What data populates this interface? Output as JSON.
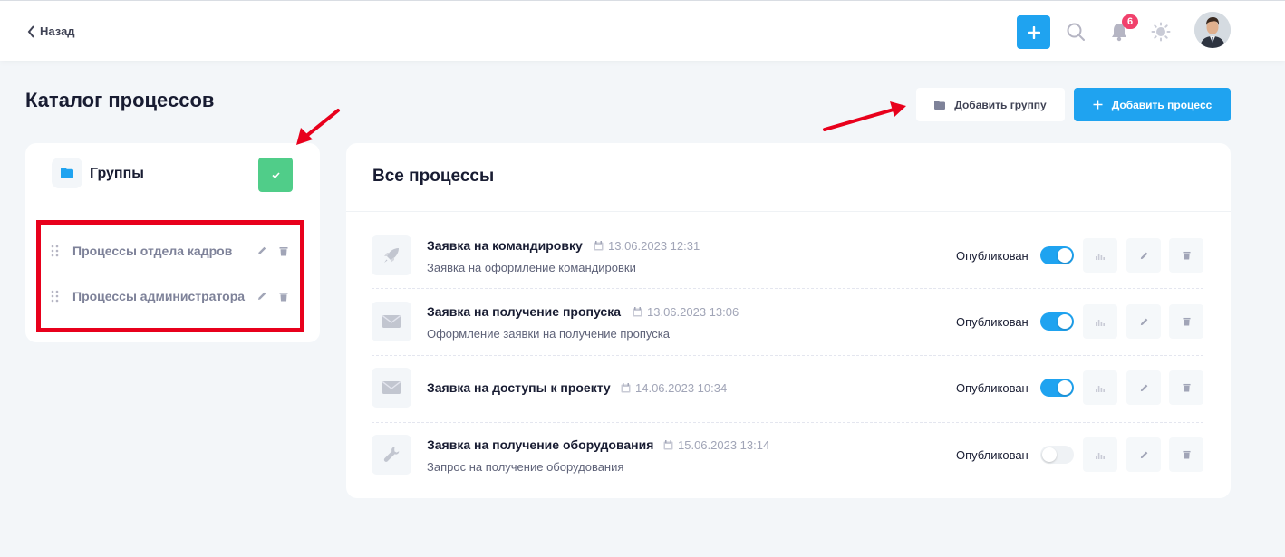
{
  "header": {
    "back_label": "Назад",
    "notifications_count": "6"
  },
  "page": {
    "title": "Каталог процессов",
    "add_group_label": "Добавить группу",
    "add_process_label": "Добавить процесс"
  },
  "groups": {
    "title": "Группы",
    "items": [
      {
        "label": "Процессы отдела кадров"
      },
      {
        "label": "Процессы администратора"
      }
    ]
  },
  "processes": {
    "title": "Все процессы",
    "items": [
      {
        "name": "Заявка на командировку",
        "date": "13.06.2023 12:31",
        "description": "Заявка на оформление командировки",
        "status": "Опубликован",
        "published": true,
        "icon": "rocket-icon"
      },
      {
        "name": "Заявка на получение пропуска",
        "date": "13.06.2023 13:06",
        "description": "Оформление заявки на получение пропуска",
        "status": "Опубликован",
        "published": true,
        "icon": "envelope-icon"
      },
      {
        "name": "Заявка на доступы к проекту",
        "date": "14.06.2023 10:34",
        "description": "",
        "status": "Опубликован",
        "published": true,
        "icon": "envelope-icon"
      },
      {
        "name": "Заявка на получение оборудования",
        "date": "15.06.2023 13:14",
        "description": "Запрос на получение оборудования",
        "status": "Опубликован",
        "published": false,
        "icon": "wrench-icon"
      }
    ]
  },
  "colors": {
    "primary": "#1fa3f0",
    "success": "#50cd89",
    "danger": "#f1416c",
    "annotation_red": "#e8001c"
  }
}
